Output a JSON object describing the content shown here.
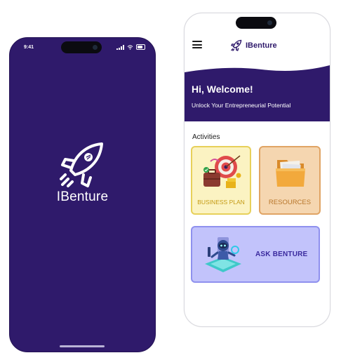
{
  "colors": {
    "brand_purple": "#2f1a6b",
    "business_plan_card": "#fbf3c2",
    "resources_card": "#f5d6b0",
    "ask_card": "#c2c3fb"
  },
  "splash": {
    "status_time": "9:41",
    "brand_name": "IBenture",
    "logo_icon": "rocket-icon"
  },
  "home": {
    "header": {
      "brand_name": "IBenture",
      "menu_icon": "hamburger-menu-icon",
      "logo_icon": "rocket-icon"
    },
    "welcome": {
      "greeting": "Hi, Welcome!",
      "tagline": "Unlock Your Entrepreneurial Potential"
    },
    "activities": {
      "title": "Activities",
      "cards": [
        {
          "label": "BUSINESS PLAN",
          "icon": "briefcase-target-icon"
        },
        {
          "label": "RESOURCES",
          "icon": "folder-icon"
        },
        {
          "label": "ASK BENTURE",
          "icon": "robot-icon"
        }
      ]
    }
  }
}
